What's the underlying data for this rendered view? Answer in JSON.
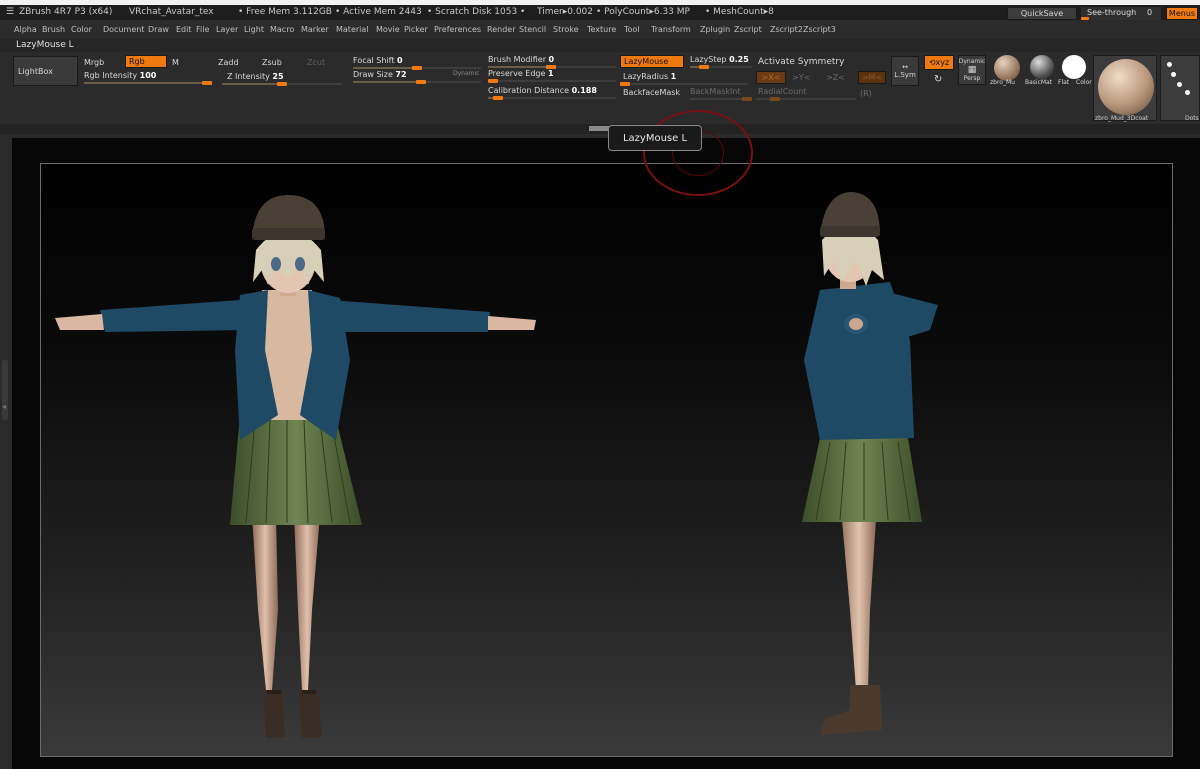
{
  "titlebar": {
    "app": "ZBrush 4R7 P3 (x64)",
    "document": "VRchat_Avatar_tex",
    "free_mem": "• Free Mem 3.112GB",
    "active_mem": "• Active Mem 2443",
    "scratch_disk": "• Scratch Disk 1053 •",
    "timer": "Timer▸0.002",
    "polycount": "• PolyCount▸6.33 MP",
    "meshcount": "• MeshCount▸8",
    "quicksave": "QuickSave",
    "see_through_label": "See-through",
    "see_through_value": "0",
    "see_through_level": 0,
    "menus": "Menus"
  },
  "menu": [
    "Alpha",
    "Brush",
    "Color",
    "Document",
    "Draw",
    "Edit",
    "File",
    "Layer",
    "Light",
    "Macro",
    "Marker",
    "Material",
    "Movie",
    "Picker",
    "Preferences",
    "Render",
    "Stencil",
    "Stroke",
    "Texture",
    "Tool",
    "Transform",
    "Zplugin",
    "Zscript",
    "Zscript2",
    "Zscript3"
  ],
  "palette_title": "LazyMouse  L",
  "toolbar": {
    "lightbox": "LightBox",
    "mrgb": "Mrgb",
    "rgb": "Rgb",
    "m": "M",
    "rgb_intensity": "Rgb Intensity",
    "rgb_intensity_value": "100",
    "zadd": "Zadd",
    "zsub": "Zsub",
    "zcut": "Zcut",
    "z_intensity": "Z Intensity",
    "z_intensity_value": "25",
    "focal_shift": "Focal Shift",
    "focal_shift_value": "0",
    "draw_size": "Draw Size",
    "draw_size_value": "72",
    "dynamic": "Dynamic",
    "brush_modifier": "Brush Modifier",
    "brush_modifier_value": "0",
    "preserve_edge": "Preserve Edge",
    "preserve_edge_value": "1",
    "calibration_distance": "Calibration Distance",
    "calibration_distance_value": "0.188",
    "lazymouse": "LazyMouse",
    "lazystep": "LazyStep",
    "lazystep_value": "0.25",
    "lazyradius": "LazyRadius",
    "lazyradius_value": "1",
    "backfacemask": "BackfaceMask",
    "backmaskint": "BackMaskInt",
    "activate_symmetry": "Activate Symmetry",
    "x_axis": ">X<",
    "y_axis": ">Y<",
    "z_axis": ">Z<",
    "m_axis": ">M<",
    "radialcount": "RadialCount",
    "r": "(R)",
    "lsym": "L.Sym",
    "xyz": "xyz",
    "dynamic_persp": "Dynamic",
    "persp": "Persp",
    "mat1": "zbro_Mu",
    "mat2": "BasicMat",
    "mat3": "Flat",
    "mat4": "Color",
    "big_mat": "zbro_Mud_3Dcoat",
    "dots": "Dots"
  },
  "tooltip": "LazyMouse  L",
  "colors": {
    "accent": "#f07a10",
    "jacket": "#1f4a66",
    "skirt": "#5c7040",
    "hat": "#4a4036",
    "skin": "#d9b7a0",
    "hair": "#d8cfb8"
  },
  "viewport": {
    "models": [
      "front-character",
      "side-character"
    ]
  }
}
